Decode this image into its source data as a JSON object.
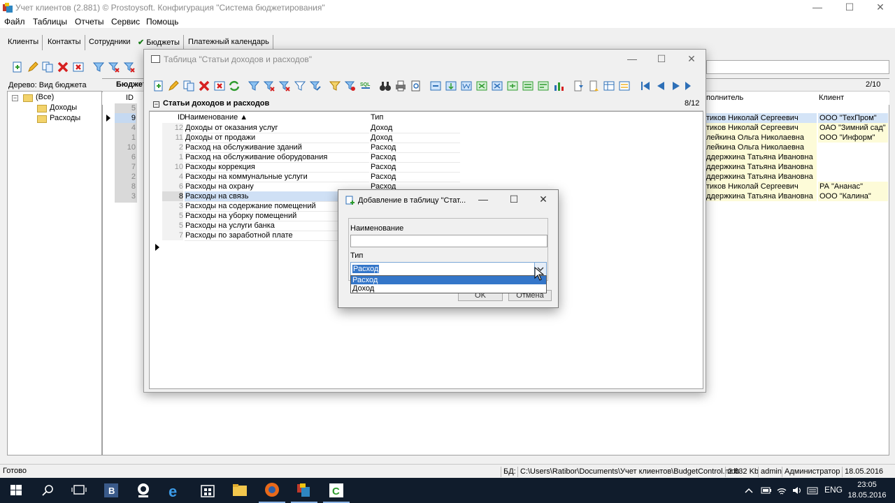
{
  "app": {
    "title": "Учет клиентов (2.881) © Prostoysoft. Конфигурация \"Система бюджетирования\"",
    "window_controls": {
      "minimize": "—",
      "maximize": "☐",
      "close": "✕"
    }
  },
  "menu": [
    "Файл",
    "Таблицы",
    "Отчеты",
    "Сервис",
    "Помощь"
  ],
  "tabs": [
    {
      "label": "Клиенты",
      "active": false
    },
    {
      "label": "Контакты",
      "active": false
    },
    {
      "label": "Сотрудники",
      "active": false
    },
    {
      "label": "Бюджеты",
      "active": true,
      "check": "✔"
    },
    {
      "label": "Платежный календарь",
      "active": false
    }
  ],
  "tree": {
    "label": "Дерево: Вид бюджета",
    "root": "(Все)",
    "toggle": "−",
    "children": [
      "Доходы",
      "Расходы"
    ]
  },
  "budget_panel": {
    "title": "Бюджет",
    "count": "2/10",
    "col_id": "ID",
    "col_executor": "полнитель",
    "col_client": "Клиент",
    "ids": [
      "5",
      "9",
      "4",
      "1",
      "10",
      "6",
      "7",
      "2",
      "8",
      "3"
    ],
    "rows": [
      {
        "executor": "",
        "client": ""
      },
      {
        "executor": "тиков Николай Сергеевич",
        "client": "ООО \"ТехПром\""
      },
      {
        "executor": "тиков Николай Сергеевич",
        "client": "ОАО \"Зимний сад\""
      },
      {
        "executor": "лейкина Ольга Николаевна",
        "client": "ООО \"Информ\""
      },
      {
        "executor": "лейкина Ольга Николаевна",
        "client": ""
      },
      {
        "executor": "ддержкина Татьяна Ивановна",
        "client": ""
      },
      {
        "executor": "ддержкина Татьяна Ивановна",
        "client": ""
      },
      {
        "executor": "ддержкина Татьяна Ивановна",
        "client": ""
      },
      {
        "executor": "тиков Николай Сергеевич",
        "client": "РА \"Ананас\""
      },
      {
        "executor": "ддержкина Татьяна Ивановна",
        "client": "ООО \"Калина\""
      }
    ]
  },
  "table_window": {
    "title": "Таблица \"Статьи доходов и расходов\"",
    "grid_title": "Статьи доходов и расходов",
    "count": "8/12",
    "headers": {
      "id": "ID",
      "name": "Наименование ▲",
      "type": "Тип"
    },
    "rows": [
      {
        "id": "12",
        "name": "Доходы от оказания услуг",
        "type": "Доход"
      },
      {
        "id": "11",
        "name": "Доходы от продажи",
        "type": "Доход"
      },
      {
        "id": "2",
        "name": "Расход на обслуживание зданий",
        "type": "Расход"
      },
      {
        "id": "1",
        "name": "Расход на обслуживание оборудования",
        "type": "Расход"
      },
      {
        "id": "10",
        "name": "Расходы коррекция",
        "type": "Расход"
      },
      {
        "id": "4",
        "name": "Расходы на коммунальные услуги",
        "type": "Расход"
      },
      {
        "id": "6",
        "name": "Расходы на охрану",
        "type": "Расход"
      },
      {
        "id": "8",
        "name": "Расходы на связь",
        "type": ""
      },
      {
        "id": "3",
        "name": "Расходы на содержание помещений",
        "type": ""
      },
      {
        "id": "5",
        "name": "Расходы на уборку помещений",
        "type": ""
      },
      {
        "id": "5",
        "name": "Расходы на услуги банка",
        "type": ""
      },
      {
        "id": "7",
        "name": "Расходы по заработной плате",
        "type": ""
      }
    ]
  },
  "dialog": {
    "title": "Добавление в таблицу \"Стат...",
    "name_label": "Наименование",
    "name_value": "",
    "type_label": "Тип",
    "type_value": "Расход",
    "options": [
      "Расход",
      "Доход"
    ],
    "ok": "OK",
    "cancel": "Отмена"
  },
  "status": {
    "ready": "Готово",
    "db_label": "БД:",
    "db_path": "C:\\Users\\Ratibor\\Documents\\Учет клиентов\\BudgetControl.mdb",
    "size": "2 632 Kb",
    "user": "admin",
    "role": "Администратор",
    "date": "18.05.2016"
  },
  "taskbar": {
    "lang": "ENG",
    "time": "23:05",
    "date": "18.05.2016"
  },
  "colors": {
    "selection": "#3476c9",
    "taskbar": "#101c2c",
    "budget_highlight": "#fdfbd8"
  }
}
